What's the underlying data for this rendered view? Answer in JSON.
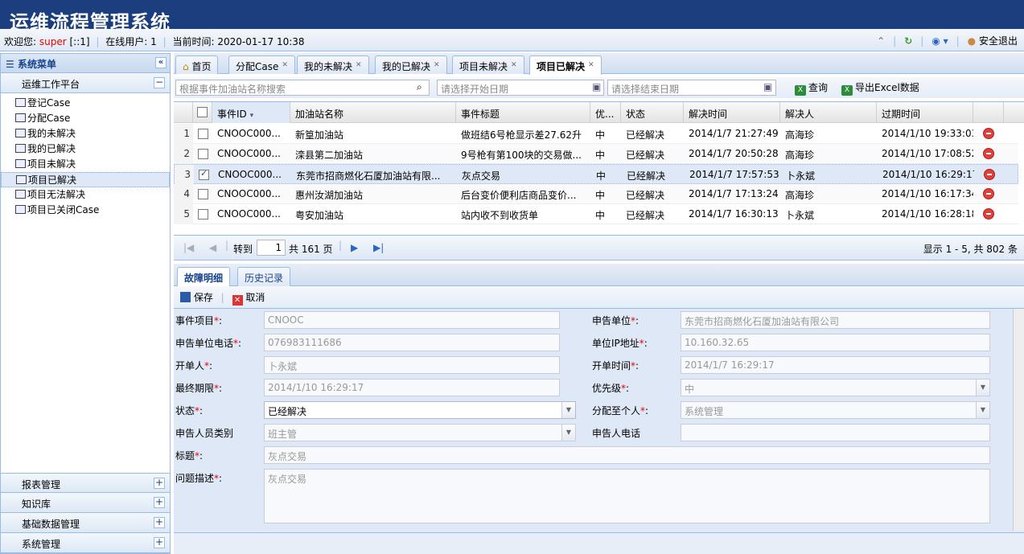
{
  "app": {
    "title": "运维流程管理系统"
  },
  "status": {
    "welcome_label": "欢迎您:",
    "user": "super",
    "ip": "[::1]",
    "online_label": "在线用户:",
    "online_count": "1",
    "time_label": "当前时间:",
    "time_value": "2020-01-17 10:38",
    "logout": "安全退出"
  },
  "sidebar": {
    "title": "系统菜单",
    "group": "运维工作平台",
    "items": [
      "登记Case",
      "分配Case",
      "我的未解决",
      "我的已解决",
      "项目未解决",
      "项目已解决",
      "项目无法解决",
      "项目已关闭Case"
    ],
    "bottom": [
      "报表管理",
      "知识库",
      "基础数据管理",
      "系统管理"
    ]
  },
  "tabs": [
    "首页",
    "分配Case",
    "我的未解决",
    "我的已解决",
    "项目未解决",
    "项目已解决"
  ],
  "toolbar": {
    "search_placeholder": "根据事件加油站名称搜索",
    "start_placeholder": "请选择开始日期",
    "end_placeholder": "请选择结束日期",
    "query": "查询",
    "export": "导出Excel数据"
  },
  "grid": {
    "columns": [
      "事件ID",
      "加油站名称",
      "事件标题",
      "优...",
      "状态",
      "解决时间",
      "解决人",
      "过期时间"
    ],
    "rows": [
      {
        "n": "1",
        "id": "CNOOC000...",
        "station": "新篁加油站",
        "title": "做班结6号枪显示差27.62升",
        "pri": "中",
        "state": "已经解决",
        "solved": "2014/1/7 21:27:49",
        "who": "高海珍",
        "expire": "2014/1/10 19:33:03",
        "checked": false
      },
      {
        "n": "2",
        "id": "CNOOC000...",
        "station": "滦县第二加油站",
        "title": "9号枪有第100块的交易做...",
        "pri": "中",
        "state": "已经解决",
        "solved": "2014/1/7 20:50:28",
        "who": "高海珍",
        "expire": "2014/1/10 17:08:52",
        "checked": false
      },
      {
        "n": "3",
        "id": "CNOOC000...",
        "station": "东莞市招商燃化石厦加油站有限...",
        "title": "灰点交易",
        "pri": "中",
        "state": "已经解决",
        "solved": "2014/1/7 17:57:53",
        "who": "卜永斌",
        "expire": "2014/1/10 16:29:17",
        "checked": true
      },
      {
        "n": "4",
        "id": "CNOOC000...",
        "station": "惠州汝湖加油站",
        "title": "后台变价便利店商品变价...",
        "pri": "中",
        "state": "已经解决",
        "solved": "2014/1/7 17:13:24",
        "who": "高海珍",
        "expire": "2014/1/10 16:17:34",
        "checked": false
      },
      {
        "n": "5",
        "id": "CNOOC000...",
        "station": "粤安加油站",
        "title": "站内收不到收货单",
        "pri": "中",
        "state": "已经解决",
        "solved": "2014/1/7 16:30:13",
        "who": "卜永斌",
        "expire": "2014/1/10 16:28:18",
        "checked": false
      }
    ]
  },
  "pager": {
    "goto": "转到",
    "page": "1",
    "total": "共 161 页",
    "display": "显示 1 - 5, 共 802 条"
  },
  "detail": {
    "tabs": [
      "故障明细",
      "历史记录"
    ],
    "save": "保存",
    "cancel": "取消",
    "labels": {
      "project": "事件项目",
      "unit": "申告单位",
      "unit_phone": "申告单位电话",
      "ip": "单位IP地址",
      "opener": "开单人",
      "open_time": "开单时间",
      "deadline": "最终期限",
      "priority": "优先级",
      "state": "状态",
      "assign": "分配至个人",
      "reporter_type": "申告人员类别",
      "reporter_phone": "申告人电话",
      "title": "标题",
      "desc": "问题描述"
    },
    "values": {
      "project": "CNOOC",
      "unit": "东莞市招商燃化石厦加油站有限公司",
      "unit_phone": "076983111686",
      "ip": "10.160.32.65",
      "opener": "卜永斌",
      "open_time": "2014/1/7 16:29:17",
      "deadline": "2014/1/10 16:29:17",
      "priority": "中",
      "state": "已经解决",
      "assign": "系统管理",
      "reporter_type": "班主管",
      "reporter_phone": "",
      "title": "灰点交易",
      "desc": "灰点交易"
    }
  }
}
